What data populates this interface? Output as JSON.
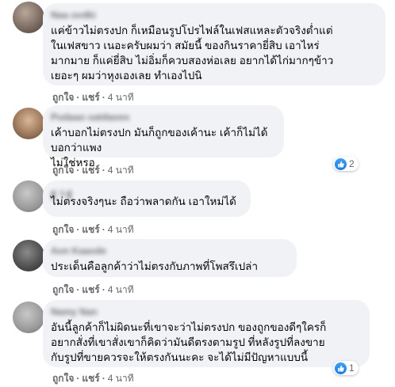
{
  "actions": {
    "like": "ถูกใจ",
    "reply": "แชร์",
    "separator": "·"
  },
  "comments": [
    {
      "name": "Naa ovdki",
      "text": "แค่ข้าวไม่ตรงปก ก็เหมือนรูปโปรไฟล์ในเฟสแหละตัวจริงต่ำแต่\nในเฟสขาว เนอะครับผมว่า สมัยนี้ ของกินราคายี่สิบ เอาไหร่\nมากมาย ก็แค่ยี่สิบ ไม่อิ่มก็ควบสองห่อเลย อยากได้ไก่มากๆข้าว\nเยอะๆ ผมว่าหุงเองเลย ทำเองไปนิ",
      "time": "4 นาที"
    },
    {
      "name": "Pudaao oatdaoes",
      "text": "เค้าบอกไม่ตรงปก มันก็ถูกของเค้านะ เค้าก็ไม่ได้บอกว่าแพง\nไม่ใช่หรอ",
      "time": "4 นาที",
      "reactions": "2"
    },
    {
      "name": "ฐ่ ว่ ฐ่",
      "text": "ไม่ตรงจริงๆนะ ถือว่าพลาดกัน เอาใหม่ได้",
      "time": "4 นาที"
    },
    {
      "name": "Aon Kaaode",
      "text": "ประเด็นคือลูกค้าว่าไม่ตรงกับภาพที่โพสรึเปล่า",
      "time": "4 นาที"
    },
    {
      "name": "Namy Nan",
      "text": "อันนี้ลูกค้าก็ไม่ผิดนะที่เขาจะว่าไม่ตรงปก ของถูกของดีๆใครก็\nอยากสั่งที่เขาสั่งเขาก็คิดว่ามันดีตรงตามรูป ที่หลังรูปที่ลงขาย\nกับรูปที่ขายควรจะให้ตรงกันนะคะ จะได้ไม่มีปัญหาแบบนี้",
      "time": "4 นาที",
      "reactions": "1"
    }
  ]
}
